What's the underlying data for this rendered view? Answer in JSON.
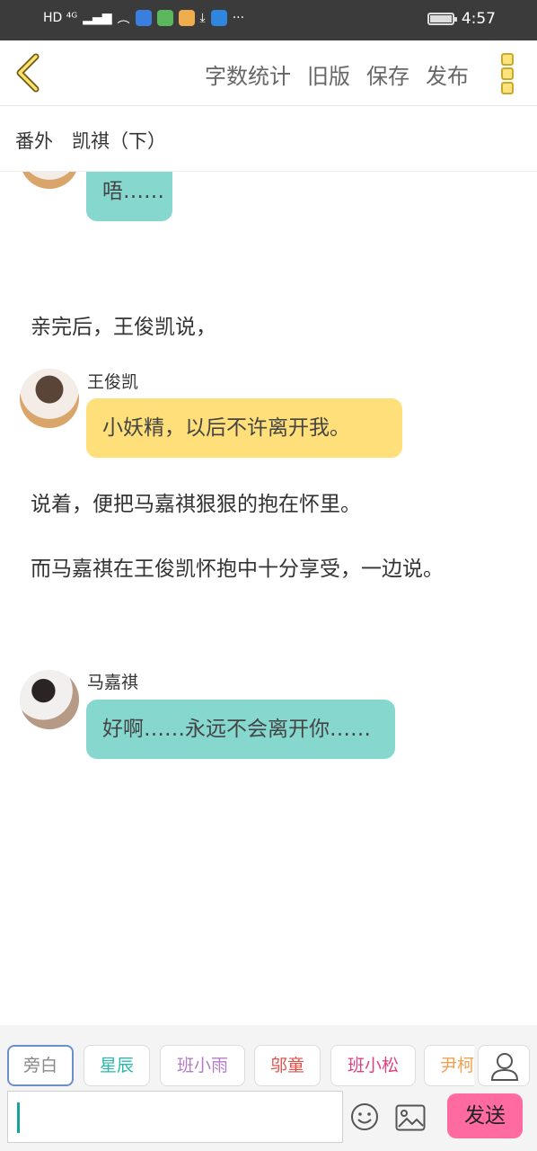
{
  "status_bar": {
    "left_text": "HD ⁴ᴳ",
    "time": "4:57"
  },
  "toolbar": {
    "items": [
      "字数统计",
      "旧版",
      "保存",
      "发布"
    ]
  },
  "chapter": {
    "tag": "番外",
    "name": "凯祺（下）"
  },
  "messages": {
    "top_bubble": "唔……",
    "narration_1": "亲完后，王俊凯说，",
    "speaker_1": "王俊凯",
    "bubble_1": "小妖精，以后不许离开我。",
    "narration_2": "说着，便把马嘉祺狠狠的抱在怀里。",
    "narration_3": "而马嘉祺在王俊凯怀抱中十分享受，一边说。",
    "speaker_2": "马嘉祺",
    "bubble_2": "好啊……永远不会离开你……"
  },
  "characters": [
    {
      "label": "旁白",
      "color": "#888888"
    },
    {
      "label": "星辰",
      "color": "#2bb7a9"
    },
    {
      "label": "班小雨",
      "color": "#b57bc7"
    },
    {
      "label": "邬童",
      "color": "#e0514a"
    },
    {
      "label": "班小松",
      "color": "#e0417f"
    },
    {
      "label": "尹柯",
      "color": "#f0a050"
    }
  ],
  "input": {
    "value": "",
    "placeholder": ""
  },
  "send_label": "发送",
  "colors": {
    "accent": "#ff6aa0",
    "teal": "#86d8cf",
    "yellow": "#ffdf7a"
  }
}
